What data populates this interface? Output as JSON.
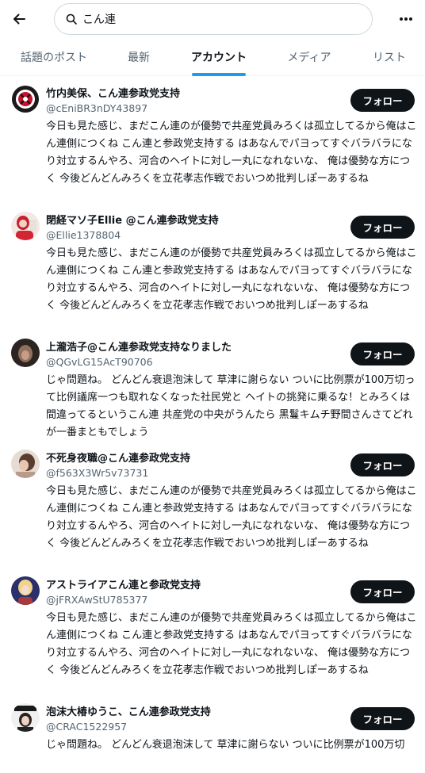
{
  "header": {
    "search_value": "こん連"
  },
  "tabs": [
    {
      "label": "話題のポスト"
    },
    {
      "label": "最新"
    },
    {
      "label": "アカウント"
    },
    {
      "label": "メディア"
    },
    {
      "label": "リスト"
    }
  ],
  "active_tab_index": 2,
  "accounts": [
    {
      "name": "竹内美保、こん連参政党支持",
      "handle": "@cEniBR3nDY43897",
      "follow_label": "フォロー",
      "bio": "今日も見た感じ、まだこん連のが優勢で共産党員みろくは孤立してるから俺はこん連側につくね こん連と参政党支持する はあなんでパヨってすぐバラバラになり対立するんやろ、河合のヘイトに対し一丸になれないな、 俺は優勢な方につく 今後どんどんみろくを立花孝志作戦でおいつめ批判しぽーあするね"
    },
    {
      "name": "閉経マソ子Ellie @こん連参政党支持",
      "handle": "@Ellie1378804",
      "follow_label": "フォロー",
      "bio": "今日も見た感じ、まだこん連のが優勢で共産党員みろくは孤立してるから俺はこん連側につくね こん連と参政党支持する はあなんでパヨってすぐバラバラになり対立するんやろ、河合のヘイトに対し一丸になれないな、 俺は優勢な方につく 今後どんどんみろくを立花孝志作戦でおいつめ批判しぽーあするね"
    },
    {
      "name": "上瀧浩子@こん連参政党支持なりました",
      "handle": "@QGvLG15AcT90706",
      "follow_label": "フォロー",
      "bio": "じゃ問題ね。 どんどん衰退泡沫して 草津に謝らない ついに比例票が100万切って比例議席一つも取れなくなった社民党と ヘイトの挑発に乗るな！とみろくは間違ってるというこん連 共産党の中央がうんたら 黒鬘キムチ野間さんさてどれが一番まともでしょう"
    },
    {
      "name": "不死身夜職@こん連参政党支持",
      "handle": "@f563X3Wr5v73731",
      "follow_label": "フォロー",
      "bio": "今日も見た感じ、まだこん連のが優勢で共産党員みろくは孤立してるから俺はこん連側につくね こん連と参政党支持する はあなんでパヨってすぐバラバラになり対立するんやろ、河合のヘイトに対し一丸になれないな、 俺は優勢な方につく 今後どんどんみろくを立花孝志作戦でおいつめ批判しぽーあするね"
    },
    {
      "name": "アストライアこん連と参政党支持",
      "handle": "@jFRXAwStU785377",
      "follow_label": "フォロー",
      "bio": "今日も見た感じ、まだこん連のが優勢で共産党員みろくは孤立してるから俺はこん連側につくね こん連と参政党支持する はあなんでパヨってすぐバラバラになり対立するんやろ、河合のヘイトに対し一丸になれないな、 俺は優勢な方につく 今後どんどんみろくを立花孝志作戦でおいつめ批判しぽーあするね"
    },
    {
      "name": "泡沫大椿ゆうこ、こん連参政党支持",
      "handle": "@CRAC1522957",
      "follow_label": "フォロー",
      "bio": "じゃ問題ね。 どんどん衰退泡沫して 草津に謝らない ついに比例票が100万切"
    }
  ]
}
